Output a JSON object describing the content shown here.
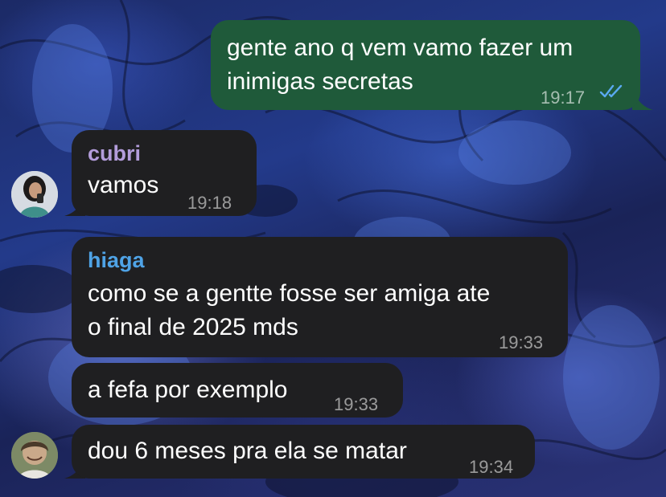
{
  "colors": {
    "outgoing_bubble": "#1f5a3a",
    "incoming_bubble": "#1f1f21",
    "sender_cubri": "#b39ddb",
    "sender_hiaga": "#4fa3e6",
    "read_ticks": "#5aa9f0"
  },
  "messages": [
    {
      "id": "m1",
      "direction": "outgoing",
      "lines": [
        "gente ano q vem vamo fazer um",
        "inimigas secretas"
      ],
      "time": "19:17",
      "status_icon": "double-check-icon"
    },
    {
      "id": "m2",
      "direction": "incoming",
      "sender": "cubri",
      "text": "vamos",
      "time": "19:18",
      "avatar_icon": "avatar-cubri"
    },
    {
      "id": "m3",
      "direction": "incoming",
      "sender": "hiaga",
      "lines": [
        "como se a gentte fosse ser amiga ate",
        "o final de 2025 mds"
      ],
      "time": "19:33"
    },
    {
      "id": "m4",
      "direction": "incoming",
      "text": "a fefa por exemplo",
      "time": "19:33"
    },
    {
      "id": "m5",
      "direction": "incoming",
      "text": "dou 6 meses pra ela se matar",
      "time": "19:34",
      "avatar_icon": "avatar-hiaga"
    }
  ]
}
